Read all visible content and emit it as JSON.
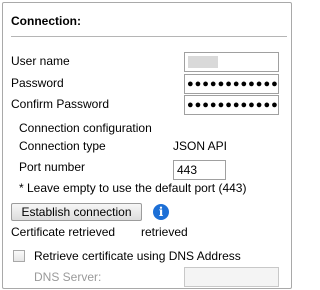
{
  "section": {
    "title": "Connection:"
  },
  "fields": {
    "username_label": "User name",
    "password_label": "Password",
    "password_value": "●●●●●●●●●●●●●●●",
    "confirm_password_label": "Confirm Password",
    "confirm_password_value": "●●●●●●●●●●●●●●●"
  },
  "configuration": {
    "heading": "Connection configuration",
    "type_label": "Connection type",
    "type_value": "JSON API",
    "port_label": "Port number",
    "port_value": "443",
    "port_hint": "* Leave empty to use the default port (443)"
  },
  "actions": {
    "establish_button": "Establish connection",
    "info_icon": "i"
  },
  "certificate": {
    "label": "Certificate retrieved",
    "value": "retrieved",
    "dns_checkbox_label": "Retrieve certificate using DNS Address",
    "dns_checked": false,
    "dns_server_label": "DNS Server:",
    "dns_server_value": ""
  },
  "colors": {
    "info_icon": "#1c6fd6",
    "panel_border": "#a9a9a9",
    "disabled_text": "#9a9a9a"
  }
}
